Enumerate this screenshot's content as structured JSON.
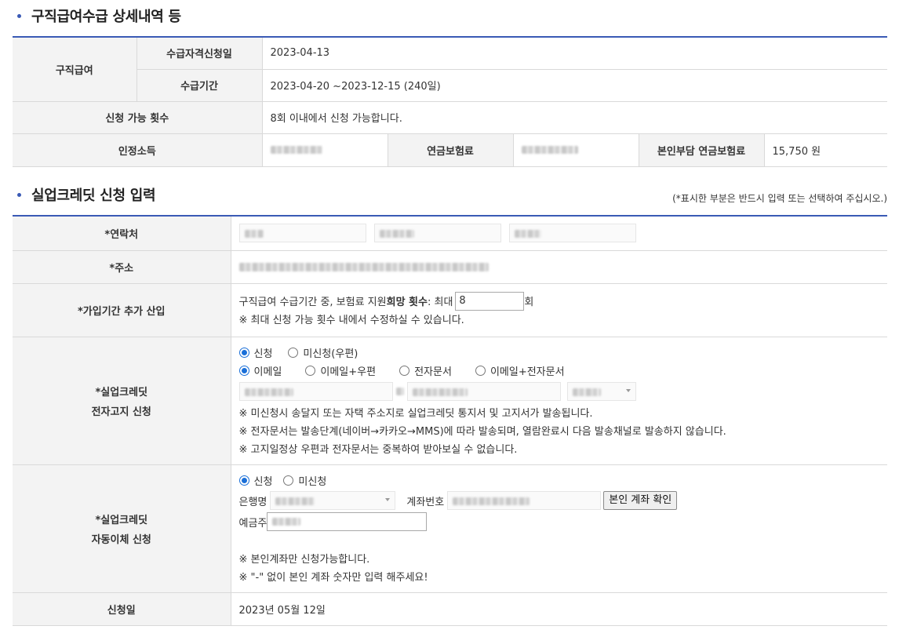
{
  "section1": {
    "title": "구직급여수급 상세내역 등",
    "job_benefit_label": "구직급여",
    "apply_date_label": "수급자격신청일",
    "apply_date": "2023-04-13",
    "period_label": "수급기간",
    "period": "2023-04-20 ~2023-12-15 (240일)",
    "count_label": "신청 가능 횟수",
    "count_value": "8회 이내에서 신청 가능합니다.",
    "income_label": "인정소득",
    "pension_label": "연금보험료",
    "self_pension_label": "본인부담 연금보험료",
    "self_pension_value": "15,750 원"
  },
  "section2": {
    "title": "실업크레딧 신청 입력",
    "note": "(*표시한 부분은 반드시 입력 또는 선택하여 주십시오.)",
    "contact_label": "*연락처",
    "address_label": "*주소",
    "extra_label": "*가입기간 추가 산입",
    "extra_text": "구직급여 수급기간 중, 보험료 지원 ",
    "extra_bold": "희망 횟수",
    "extra_text2": " : 최대",
    "extra_value": "8",
    "extra_unit": "회",
    "extra_note": "※ 최대 신청 가능 횟수 내에서 수정하실 수 있습니다.",
    "notice_label_1": "*실업크레딧",
    "notice_label_2": "전자고지 신청",
    "notice_apply": "신청",
    "notice_no_apply": "미신청(우편)",
    "opt_email": "이메일",
    "opt_email_post": "이메일+우편",
    "opt_edoc": "전자문서",
    "opt_email_edoc": "이메일+전자문서",
    "notice_note1": "※ 미신청시 송달지 또는 자택 주소지로 실업크레딧 통지서 및 고지서가 발송됩니다.",
    "notice_note2": "※ 전자문서는 발송단계(네이버→카카오→MMS)에 따라 발송되며, 열람완료시 다음 발송채널로 발송하지 않습니다.",
    "notice_note3": "※ 고지일정상 우편과 전자문서는 중복하여 받아보실 수 없습니다.",
    "auto_label_1": "*실업크레딧",
    "auto_label_2": "자동이체 신청",
    "auto_apply": "신청",
    "auto_no_apply": "미신청",
    "bank_label": "은행명",
    "account_label": "계좌번호",
    "verify_button": "본인 계좌 확인",
    "holder_label": "예금주",
    "auto_note1": "※ 본인계좌만 신청가능합니다.",
    "auto_note2": "※ \"-\" 없이 본인 계좌 숫자만 입력 해주세요!",
    "date_label": "신청일",
    "date_value": "2023년 05월 12일"
  },
  "colors": {
    "accent": "#3a5ab5",
    "radio": "#1a6fd8",
    "header_bg": "#f3f3f3"
  }
}
